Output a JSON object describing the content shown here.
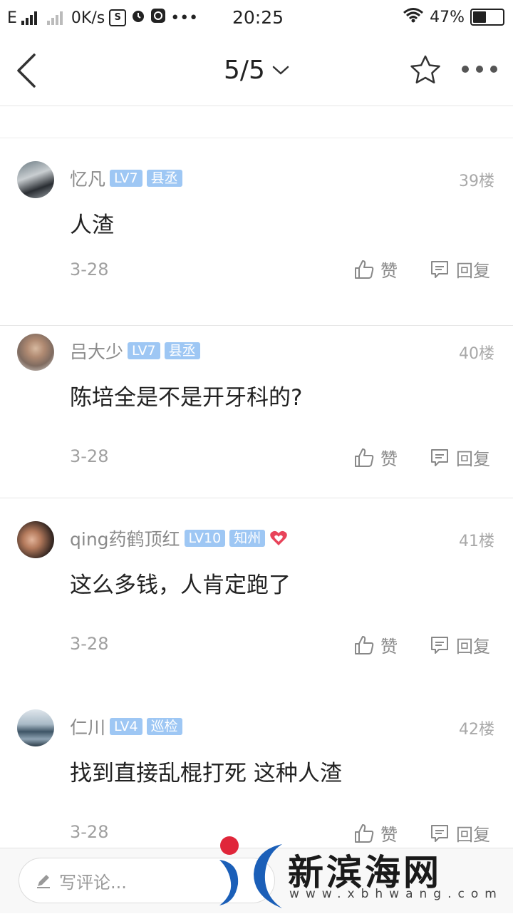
{
  "status_bar": {
    "network": "E",
    "speed": "0K/s",
    "time": "20:25",
    "battery": "47%"
  },
  "nav": {
    "page_indicator": "5/5"
  },
  "comments": [
    {
      "username": "忆凡",
      "level": "LV7",
      "title": "县丞",
      "floor": "39楼",
      "text": "人渣",
      "date": "3-28",
      "like_label": "赞",
      "reply_label": "回复"
    },
    {
      "username": "吕大少",
      "level": "LV7",
      "title": "县丞",
      "floor": "40楼",
      "text": "陈培全是不是开牙科的?",
      "date": "3-28",
      "like_label": "赞",
      "reply_label": "回复"
    },
    {
      "username": "qing药鹤顶红",
      "level": "LV10",
      "title": "知州",
      "floor": "41楼",
      "text": "这么多钱，人肯定跑了",
      "date": "3-28",
      "like_label": "赞",
      "reply_label": "回复"
    },
    {
      "username": "仁川",
      "level": "LV4",
      "title": "巡检",
      "floor": "42楼",
      "text": "找到直接乱棍打死 这种人渣",
      "date": "3-28",
      "like_label": "赞",
      "reply_label": "回复"
    }
  ],
  "bottom_bar": {
    "comment_placeholder": "写评论..."
  },
  "watermark": {
    "title": "新滨海网",
    "url": "www.xbhwang.com"
  },
  "colors": {
    "badge": "#9ec7f4",
    "heart": "#e8445a",
    "text_gray": "#8a8a8a"
  }
}
